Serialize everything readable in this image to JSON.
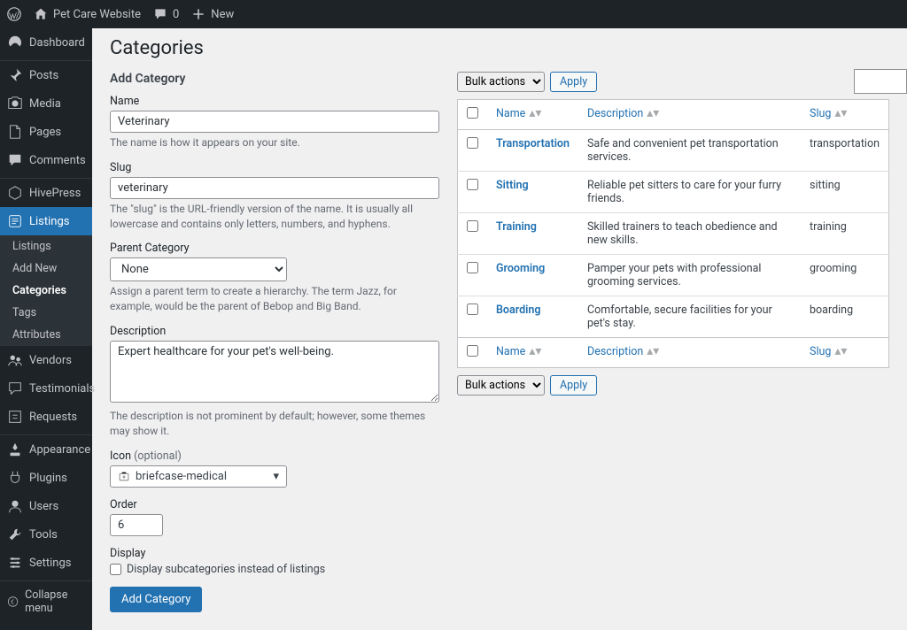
{
  "adminbar": {
    "site_name": "Pet Care Website",
    "comments_count": "0",
    "new_label": "New"
  },
  "sidebar": {
    "items": [
      {
        "key": "dashboard",
        "label": "Dashboard"
      },
      {
        "key": "posts",
        "label": "Posts"
      },
      {
        "key": "media",
        "label": "Media"
      },
      {
        "key": "pages",
        "label": "Pages"
      },
      {
        "key": "comments",
        "label": "Comments"
      },
      {
        "key": "hivepress",
        "label": "HivePress"
      },
      {
        "key": "listings",
        "label": "Listings"
      },
      {
        "key": "vendors",
        "label": "Vendors"
      },
      {
        "key": "testimonials",
        "label": "Testimonials"
      },
      {
        "key": "requests",
        "label": "Requests"
      },
      {
        "key": "appearance",
        "label": "Appearance"
      },
      {
        "key": "plugins",
        "label": "Plugins"
      },
      {
        "key": "users",
        "label": "Users"
      },
      {
        "key": "tools",
        "label": "Tools"
      },
      {
        "key": "settings",
        "label": "Settings"
      }
    ],
    "submenu": {
      "items": [
        {
          "label": "Listings"
        },
        {
          "label": "Add New"
        },
        {
          "label": "Categories"
        },
        {
          "label": "Tags"
        },
        {
          "label": "Attributes"
        }
      ]
    },
    "collapse_label": "Collapse menu"
  },
  "page": {
    "title": "Categories"
  },
  "form": {
    "heading": "Add Category",
    "name_label": "Name",
    "name_value": "Veterinary",
    "name_help": "The name is how it appears on your site.",
    "slug_label": "Slug",
    "slug_value": "veterinary",
    "slug_help": "The \"slug\" is the URL-friendly version of the name. It is usually all lowercase and contains only letters, numbers, and hyphens.",
    "parent_label": "Parent Category",
    "parent_value": "None",
    "parent_help": "Assign a parent term to create a hierarchy. The term Jazz, for example, would be the parent of Bebop and Big Band.",
    "desc_label": "Description",
    "desc_value": "Expert healthcare for your pet's well-being.",
    "desc_help": "The description is not prominent by default; however, some themes may show it.",
    "icon_label": "Icon",
    "icon_optional": "(optional)",
    "icon_value": "briefcase-medical",
    "order_label": "Order",
    "order_value": "6",
    "display_label": "Display",
    "display_cb_label": "Display subcategories instead of listings",
    "submit_label": "Add Category"
  },
  "table": {
    "bulk_label": "Bulk actions",
    "apply_label": "Apply",
    "columns": {
      "name": "Name",
      "description": "Description",
      "slug": "Slug"
    },
    "rows": [
      {
        "name": "Transportation",
        "description": "Safe and convenient pet transportation services.",
        "slug": "transportation"
      },
      {
        "name": "Sitting",
        "description": "Reliable pet sitters to care for your furry friends.",
        "slug": "sitting"
      },
      {
        "name": "Training",
        "description": "Skilled trainers to teach obedience and new skills.",
        "slug": "training"
      },
      {
        "name": "Grooming",
        "description": "Pamper your pets with professional grooming services.",
        "slug": "grooming"
      },
      {
        "name": "Boarding",
        "description": "Comfortable, secure facilities for your pet's stay.",
        "slug": "boarding"
      }
    ]
  }
}
